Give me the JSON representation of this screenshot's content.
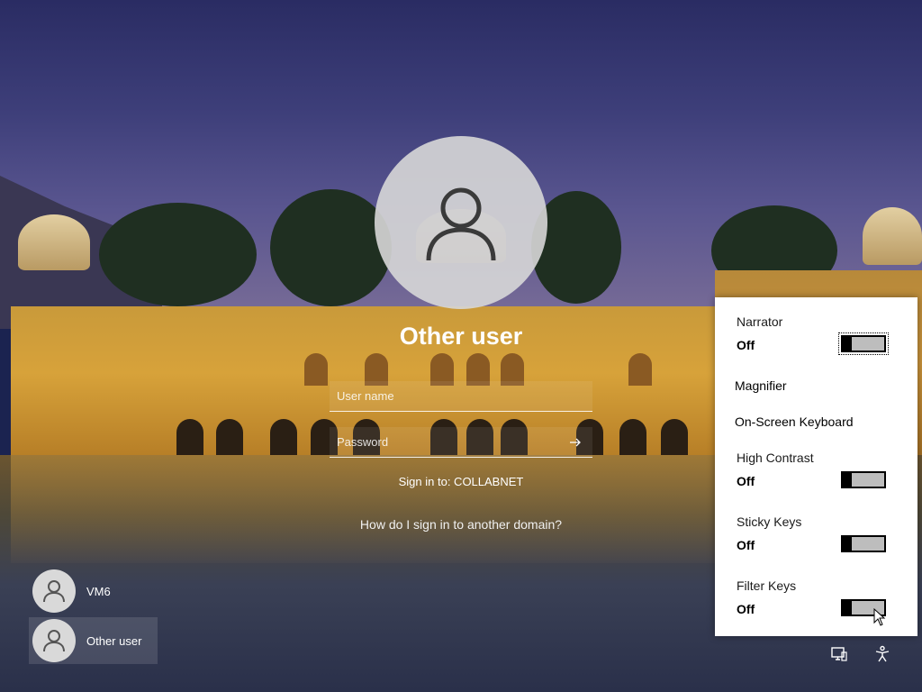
{
  "signin": {
    "username": "Other user",
    "username_placeholder": "User name",
    "password_placeholder": "Password",
    "sign_in_to": "Sign in to: COLLABNET",
    "other_domain_link": "How do I sign in to another domain?"
  },
  "users": [
    {
      "name": "VM6",
      "icon": "person-icon",
      "selected": false
    },
    {
      "name": "Other user",
      "icon": "person-icon",
      "selected": true
    }
  ],
  "accessibility": {
    "narrator": {
      "label": "Narrator",
      "state": "Off"
    },
    "magnifier": {
      "label": "Magnifier"
    },
    "on_screen_keyboard": {
      "label": "On-Screen Keyboard"
    },
    "high_contrast": {
      "label": "High Contrast",
      "state": "Off"
    },
    "sticky_keys": {
      "label": "Sticky Keys",
      "state": "Off"
    },
    "filter_keys": {
      "label": "Filter Keys",
      "state": "Off"
    }
  },
  "icons": {
    "network": "network-icon",
    "accessibility": "accessibility-icon",
    "submit": "arrow-right-icon"
  },
  "colors": {
    "flyout_bg": "#ffffff",
    "toggle_track": "#bdbdbd",
    "toggle_knob": "#000000"
  }
}
